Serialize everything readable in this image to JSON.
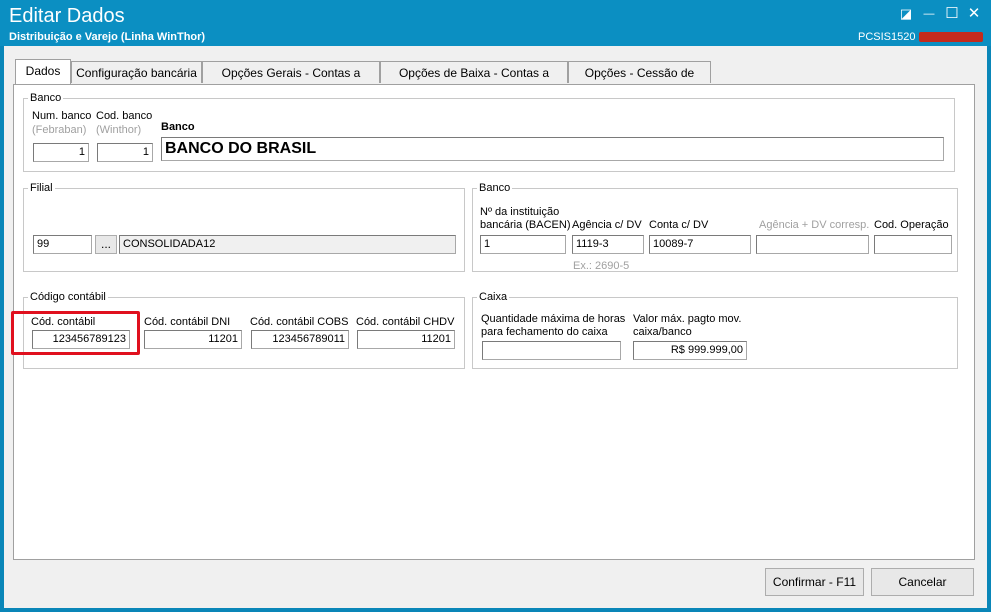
{
  "window": {
    "title": "Editar Dados",
    "subtitle": "Distribuição e Varejo (Linha WinThor)",
    "routine_code": "PCSIS1520",
    "controls": {
      "restore": "◪",
      "minimize": "—",
      "maximize": "☐",
      "close": "✕"
    }
  },
  "tabs": [
    {
      "label": "Dados",
      "active": true
    },
    {
      "label": "Configuração bancária"
    },
    {
      "label": "Opções Gerais - Contas a Receber"
    },
    {
      "label": "Opções de Baixa - Contas a Receber"
    },
    {
      "label": "Opções - Cessão de crédito"
    }
  ],
  "banco_group": {
    "legend": "Banco",
    "num_banco_label": "Num. banco",
    "num_banco_sub": "(Febraban)",
    "num_banco_value": "1",
    "cod_banco_label": "Cod. banco",
    "cod_banco_sub": "(Winthor)",
    "cod_banco_value": "1",
    "banco_label": "Banco",
    "banco_value": "BANCO DO BRASIL"
  },
  "filial_group": {
    "legend": "Filial",
    "code": "99",
    "browse_label": "...",
    "name": "CONSOLIDADA12"
  },
  "banco_info_group": {
    "legend": "Banco",
    "instituicao_label_1": "Nº da instituição",
    "instituicao_label_2": "bancária (BACEN)",
    "instituicao_value": "1",
    "agencia_label": "Agência c/ DV",
    "agencia_value": "1119-3",
    "agencia_hint": "Ex.: 2690-5",
    "conta_label": "Conta c/ DV",
    "conta_value": "10089-7",
    "agencia_corresp_label": "Agência + DV corresp.",
    "agencia_corresp_value": "",
    "cod_operacao_label": "Cod. Operação",
    "cod_operacao_value": ""
  },
  "codigo_contabil_group": {
    "legend": "Código contábil",
    "cod_contabil_label": "Cód. contábil",
    "cod_contabil_value": "123456789123",
    "dni_label": "Cód. contábil DNI",
    "dni_value": "11201",
    "cobs_label": "Cód. contábil COBS",
    "cobs_value": "123456789011",
    "chdv_label": "Cód. contábil CHDV",
    "chdv_value": "11201",
    "highlight_color": "#e0101e"
  },
  "caixa_group": {
    "legend": "Caixa",
    "horas_label_1": "Quantidade máxima de horas",
    "horas_label_2": "para fechamento do caixa",
    "horas_value": "",
    "valor_label_1": "Valor máx. pagto mov.",
    "valor_label_2": "caixa/banco",
    "valor_value": "R$ 999.999,00"
  },
  "footer": {
    "confirm_label": "Confirmar - F11",
    "cancel_label": "Cancelar"
  },
  "colors": {
    "titlebar": "#0b8fc2",
    "window_bg": "#f0f0f0",
    "highlight": "#e0101e"
  }
}
